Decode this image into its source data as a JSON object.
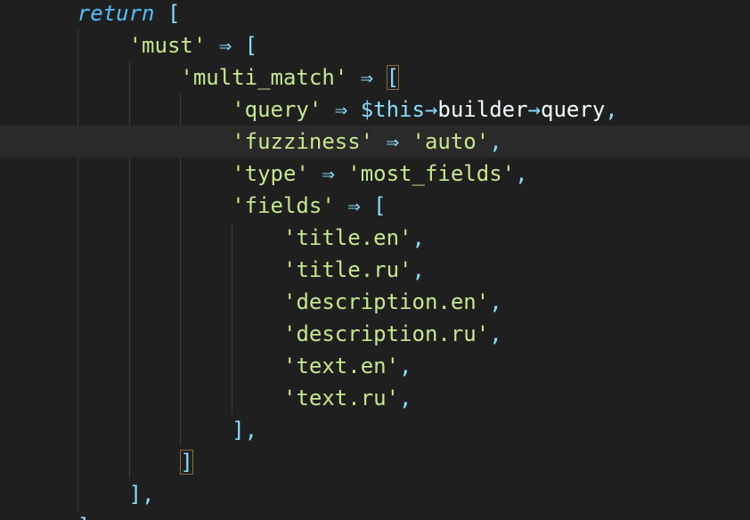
{
  "editor": {
    "colors": {
      "background": "#1f1f1f",
      "current_line": "#2a2a2a",
      "keyword": "#4fc1ff",
      "string": "#c3e88d",
      "operator": "#89ddff",
      "identifier": "#eeffff",
      "indent_guide": "#3b3b3b",
      "bracket_match": "#8a6d3b"
    },
    "current_line_index": 4,
    "lines": [
      {
        "indent": 2,
        "tokens": [
          {
            "t": "kw",
            "v": "return"
          },
          {
            "t": "punc",
            "v": " ["
          }
        ]
      },
      {
        "indent": 3,
        "tokens": [
          {
            "t": "str",
            "v": "'must'"
          },
          {
            "t": "op",
            "v": " ⇒ "
          },
          {
            "t": "punc",
            "v": "["
          }
        ]
      },
      {
        "indent": 4,
        "tokens": [
          {
            "t": "str",
            "v": "'multi_match'"
          },
          {
            "t": "op",
            "v": " ⇒ "
          },
          {
            "t": "punc",
            "v": "[",
            "match": true
          }
        ]
      },
      {
        "indent": 5,
        "tokens": [
          {
            "t": "str",
            "v": "'query'"
          },
          {
            "t": "op",
            "v": " ⇒ "
          },
          {
            "t": "var",
            "v": "$this"
          },
          {
            "t": "op",
            "v": "→"
          },
          {
            "t": "prop",
            "v": "builder"
          },
          {
            "t": "op",
            "v": "→"
          },
          {
            "t": "prop",
            "v": "query"
          },
          {
            "t": "punc",
            "v": ","
          }
        ]
      },
      {
        "indent": 5,
        "tokens": [
          {
            "t": "str",
            "v": "'fuzziness'"
          },
          {
            "t": "op",
            "v": " ⇒ "
          },
          {
            "t": "str",
            "v": "'auto'"
          },
          {
            "t": "punc",
            "v": ","
          }
        ]
      },
      {
        "indent": 5,
        "tokens": [
          {
            "t": "str",
            "v": "'type'"
          },
          {
            "t": "op",
            "v": " ⇒ "
          },
          {
            "t": "str",
            "v": "'most_fields'"
          },
          {
            "t": "punc",
            "v": ","
          }
        ]
      },
      {
        "indent": 5,
        "tokens": [
          {
            "t": "str",
            "v": "'fields'"
          },
          {
            "t": "op",
            "v": " ⇒ "
          },
          {
            "t": "punc",
            "v": "["
          }
        ]
      },
      {
        "indent": 6,
        "tokens": [
          {
            "t": "str",
            "v": "'title.en'"
          },
          {
            "t": "punc",
            "v": ","
          }
        ]
      },
      {
        "indent": 6,
        "tokens": [
          {
            "t": "str",
            "v": "'title.ru'"
          },
          {
            "t": "punc",
            "v": ","
          }
        ]
      },
      {
        "indent": 6,
        "tokens": [
          {
            "t": "str",
            "v": "'description.en'"
          },
          {
            "t": "punc",
            "v": ","
          }
        ]
      },
      {
        "indent": 6,
        "tokens": [
          {
            "t": "str",
            "v": "'description.ru'"
          },
          {
            "t": "punc",
            "v": ","
          }
        ]
      },
      {
        "indent": 6,
        "tokens": [
          {
            "t": "str",
            "v": "'text.en'"
          },
          {
            "t": "punc",
            "v": ","
          }
        ]
      },
      {
        "indent": 6,
        "tokens": [
          {
            "t": "str",
            "v": "'text.ru'"
          },
          {
            "t": "punc",
            "v": ","
          }
        ]
      },
      {
        "indent": 5,
        "tokens": [
          {
            "t": "punc",
            "v": "],"
          }
        ]
      },
      {
        "indent": 4,
        "tokens": [
          {
            "t": "punc",
            "v": "]",
            "match": true
          }
        ]
      },
      {
        "indent": 3,
        "tokens": [
          {
            "t": "punc",
            "v": "],"
          }
        ]
      },
      {
        "indent": 2,
        "tokens": [
          {
            "t": "punc",
            "v": "];"
          }
        ]
      }
    ]
  }
}
